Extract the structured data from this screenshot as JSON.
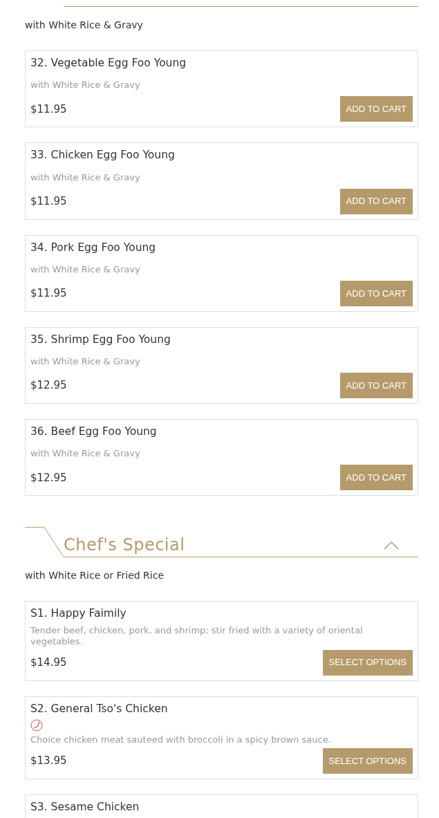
{
  "sections": [
    {
      "subtitle": "with White Rice & Gravy",
      "items": [
        {
          "name": "32. Vegetable Egg Foo Young",
          "description": "with White Rice & Gravy",
          "price": "$11.95",
          "button": "ADD TO CART",
          "spicy": false
        },
        {
          "name": "33. Chicken Egg Foo Young",
          "description": "with White Rice & Gravy",
          "price": "$11.95",
          "button": "ADD TO CART",
          "spicy": false
        },
        {
          "name": "34. Pork Egg Foo Young",
          "description": "with White Rice & Gravy",
          "price": "$11.95",
          "button": "ADD TO CART",
          "spicy": false
        },
        {
          "name": "35. Shrimp Egg Foo Young",
          "description": "with White Rice & Gravy",
          "price": "$12.95",
          "button": "ADD TO CART",
          "spicy": false
        },
        {
          "name": "36. Beef Egg Foo Young",
          "description": "with White Rice & Gravy",
          "price": "$12.95",
          "button": "ADD TO CART",
          "spicy": false
        }
      ]
    },
    {
      "title": "Chef's Special",
      "expanded": true,
      "subtitle": "with White Rice or Fried Rice",
      "items": [
        {
          "name": "S1. Happy Faimily",
          "description": "Tender beef, chicken, pork, and shrimp; stir fried with a variety of oriental vegetables.",
          "price": "$14.95",
          "button": "SELECT OPTIONS",
          "spicy": false
        },
        {
          "name": "S2. General Tso's Chicken",
          "description": "Choice chicken meat sauteed with broccoli in a spicy brown sauce.",
          "price": "$13.95",
          "button": "SELECT OPTIONS",
          "spicy": true
        },
        {
          "name": "S3. Sesame Chicken"
        }
      ]
    }
  ]
}
